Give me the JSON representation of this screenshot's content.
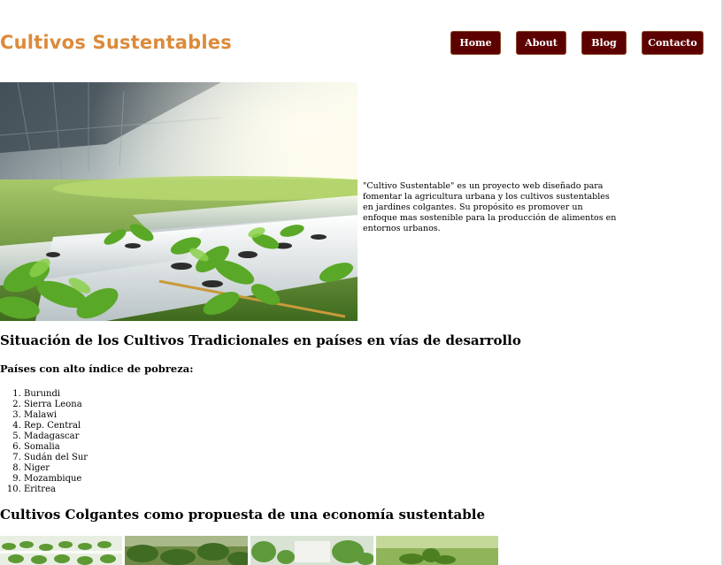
{
  "header": {
    "site_title": "Cultivos Sustentables",
    "nav": [
      {
        "label": "Home"
      },
      {
        "label": "About"
      },
      {
        "label": "Blog"
      },
      {
        "label": "Contacto"
      }
    ]
  },
  "intro": {
    "text": "\"Cultivo Sustentable\" es un proyecto web diseñado para fomentar la agricultura urbana y los cultivos sustentables en jardines colgantes. Su propósito es promover un enfoque mas sostenible para la producción de alimentos en entornos urbanos."
  },
  "section_situacion": {
    "heading": "Situación de los Cultivos Tradicionales en países en vías de desarrollo",
    "subheading": "Países con alto índice de pobreza:",
    "countries": [
      "Burundi",
      "Sierra Leona",
      "Malawi",
      "Rep. Central",
      "Madagascar",
      "Somalia",
      "Sudán del Sur",
      "Niger",
      "Mozambique",
      "Eritrea"
    ]
  },
  "section_colgantes": {
    "heading": "Cultivos Colgantes como propuesta de una economía sustentable"
  },
  "colors": {
    "title_orange": "#dc8a3a",
    "nav_bg": "#5c0000"
  }
}
